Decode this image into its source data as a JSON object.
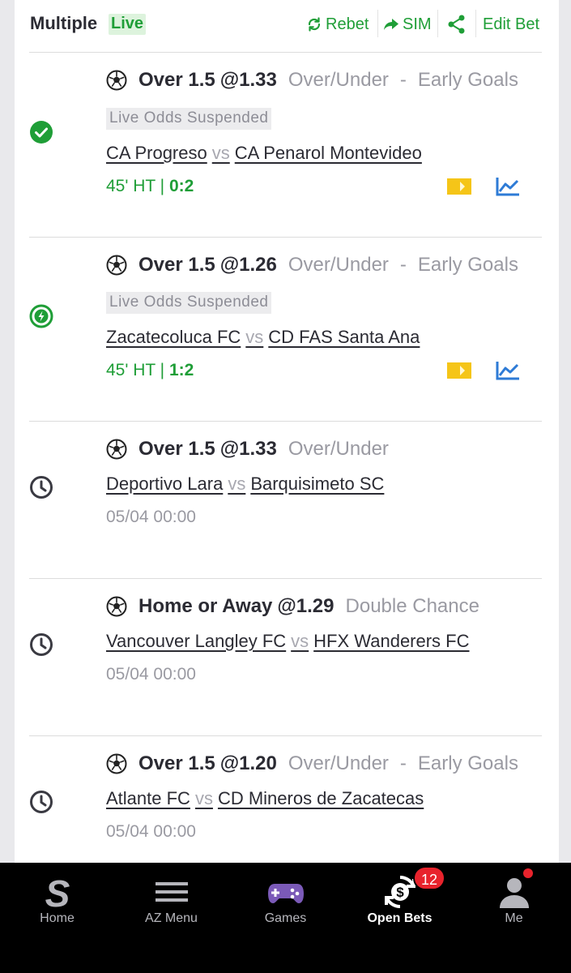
{
  "header": {
    "title": "Multiple",
    "live_badge": "Live",
    "rebet_label": "Rebet",
    "sim_label": "SIM",
    "edit_bet_label": "Edit Bet"
  },
  "colors": {
    "accent_green": "#1f9e37",
    "link_blue": "#2e7bd6",
    "tv_yellow": "#f5c518",
    "badge_red": "#e8232c"
  },
  "bets": [
    {
      "status_icon": "check-circle-icon",
      "selection": "Over 1.5",
      "odds": "@1.33",
      "market": "Over/Under",
      "separator": "-",
      "sub_market": "Early Goals",
      "suspended_label": "Live Odds Suspended",
      "home": "CA Progreso",
      "vs": "vs",
      "away": "CA Penarol Montevideo",
      "clock": "45' HT |",
      "score": "0:2"
    },
    {
      "status_icon": "lightning-circle-icon",
      "selection": "Over 1.5",
      "odds": "@1.26",
      "market": "Over/Under",
      "separator": "-",
      "sub_market": "Early Goals",
      "suspended_label": "Live Odds Suspended",
      "home": "Zacatecoluca FC",
      "vs": "vs",
      "away": "CD FAS Santa Ana",
      "clock": "45' HT |",
      "score": "1:2"
    },
    {
      "status_icon": "clock-icon",
      "selection": "Over 1.5",
      "odds": "@1.33",
      "market": "Over/Under",
      "home": "Deportivo Lara",
      "vs": "vs",
      "away": "Barquisimeto SC",
      "kickoff": "05/04 00:00"
    },
    {
      "status_icon": "clock-icon",
      "selection": "Home or Away",
      "odds": "@1.29",
      "market": "Double Chance",
      "home": "Vancouver Langley FC",
      "vs": "vs",
      "away": "HFX Wanderers FC",
      "kickoff": "05/04 00:00"
    },
    {
      "status_icon": "clock-icon",
      "selection": "Over 1.5",
      "odds": "@1.20",
      "market": "Over/Under",
      "separator": "-",
      "sub_market": "Early Goals",
      "home": "Atlante FC",
      "vs": "vs",
      "away": "CD Mineros de Zacatecas",
      "kickoff": "05/04 00:00"
    }
  ],
  "nav": {
    "home_label": "Home",
    "az_menu_label": "AZ Menu",
    "games_label": "Games",
    "open_bets_label": "Open Bets",
    "open_bets_count": "12",
    "me_label": "Me"
  }
}
